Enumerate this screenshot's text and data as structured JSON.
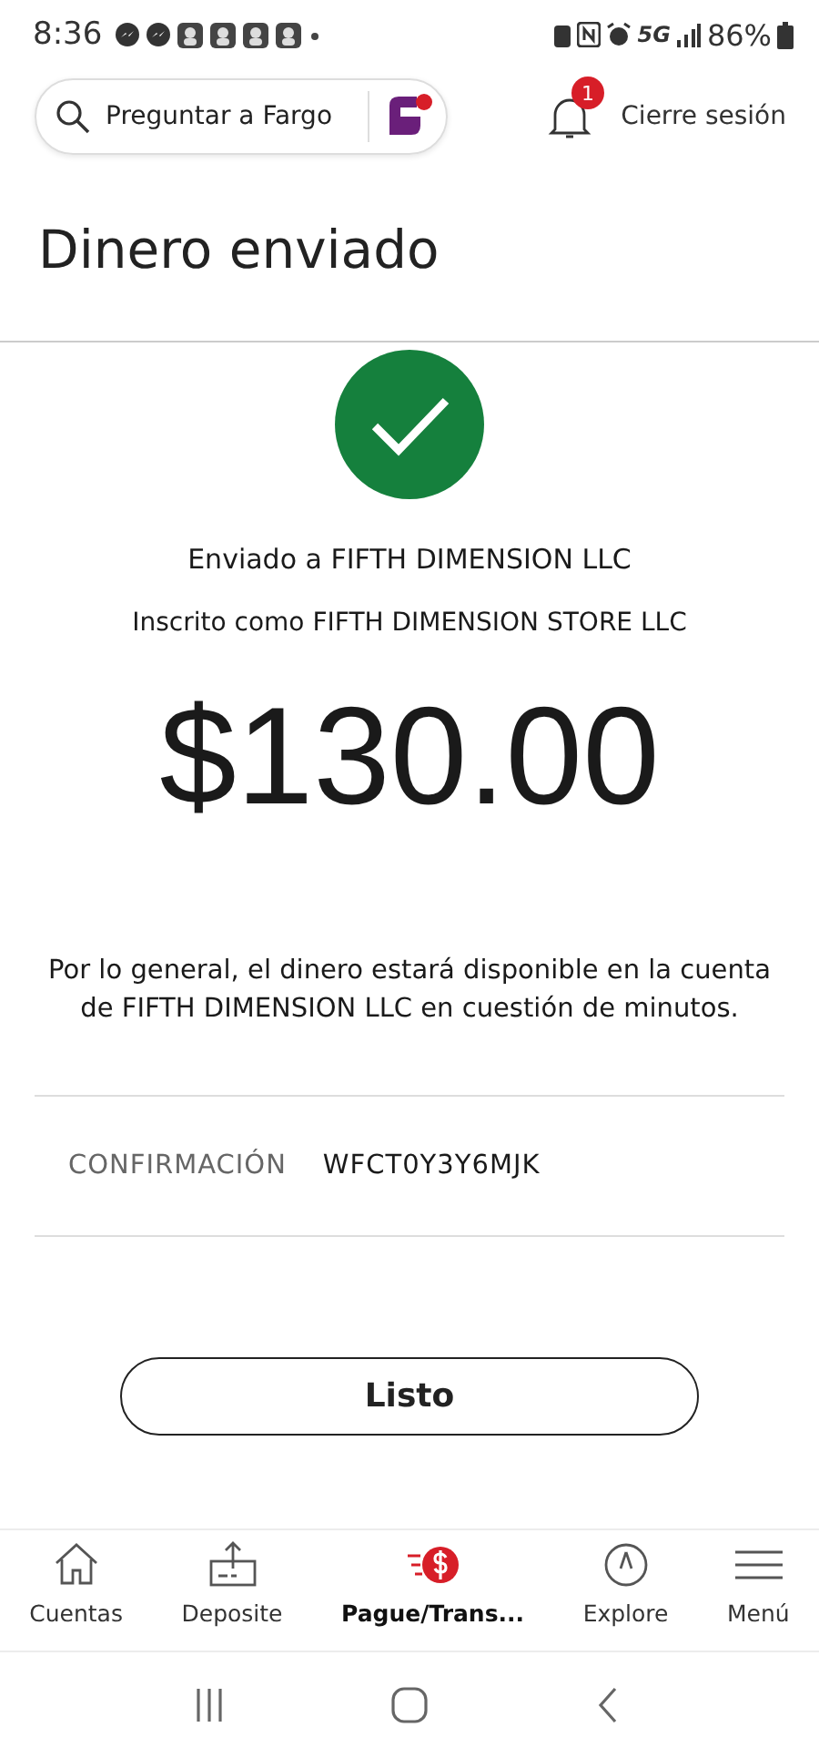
{
  "status_bar": {
    "time": "8:36",
    "network": "5G",
    "battery": "86%"
  },
  "header": {
    "search": {
      "placeholder": "Preguntar a Fargo"
    },
    "notifications": "1",
    "logout": "Cierre sesión"
  },
  "title": "Dinero enviado",
  "sent_to": "Enviado a FIFTH DIMENSION LLC",
  "enrolled_as": "Inscrito como FIFTH DIMENSION STORE LLC",
  "amount": "$130.00",
  "note": "Por lo general, el dinero estará disponible en la cuenta de FIFTH DIMENSION LLC en cuestión de minutos.",
  "confirmation": {
    "label": "CONFIRMACIÓN",
    "value": "WFCT0Y3Y6MJK"
  },
  "done_button": "Listo",
  "nav": [
    {
      "kind": "home",
      "label": "Cuentas",
      "selected": false
    },
    {
      "kind": "deposit",
      "label": "Deposite",
      "selected": false
    },
    {
      "kind": "pay",
      "label": "Pague/Trans...",
      "selected": true
    },
    {
      "kind": "explore",
      "label": "Explore",
      "selected": false
    },
    {
      "kind": "menu",
      "label": "Menú",
      "selected": false
    }
  ]
}
